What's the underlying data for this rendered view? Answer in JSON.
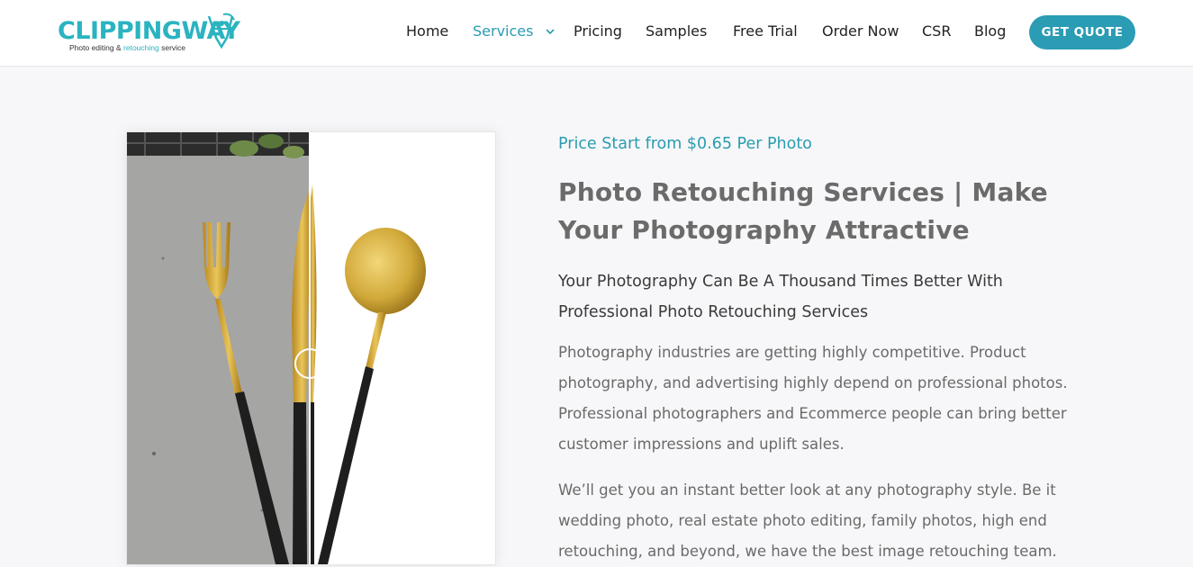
{
  "logo": {
    "name": "CLIPPINGWAY",
    "tagline_pre": "Photo editing &",
    "tagline_highlight": "retouching",
    "tagline_post": "service"
  },
  "nav": {
    "items": [
      {
        "label": "Home"
      },
      {
        "label": "Services"
      },
      {
        "label": "Pricing"
      },
      {
        "label": "Samples"
      },
      {
        "label": "Free Trial"
      },
      {
        "label": "Order Now"
      },
      {
        "label": "CSR"
      },
      {
        "label": "Blog"
      }
    ],
    "cta_label": "GET QUOTE"
  },
  "hero": {
    "price_line": "Price Start from $0.65 Per Photo",
    "title": "Photo Retouching Services | Make Your Photography Attractive",
    "subtitle": "Your Photography Can Be A Thousand Times Better With Professional Photo Retouching Services",
    "paragraph_1": "Photography industries are getting highly competitive. Product photography, and advertising highly depend on professional photos. Professional photographers and Ecommerce people can bring better customer impressions and uplift sales.",
    "paragraph_2": "We’ll get you an instant better look at any photography style. Be it wedding photo, real estate photo editing, family photos, high end retouching, and beyond, we have the best image retouching team."
  },
  "colors": {
    "accent": "#2a9cb0",
    "cta_background": "#2a9cb4",
    "title_text": "#6b6b6b",
    "page_background": "#f7f7f9"
  },
  "icons": {
    "services_dropdown": "chevron-down-icon",
    "logo_mark": "camera-pen-icon",
    "compare_handle": "slider-handle-icon"
  }
}
